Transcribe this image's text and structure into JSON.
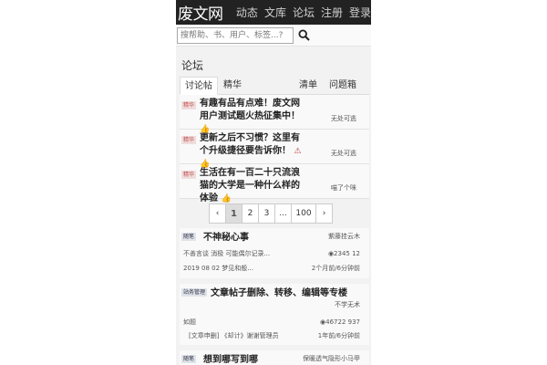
{
  "navbar": {
    "logo": "废文网",
    "items": [
      "动态",
      "文库",
      "论坛",
      "注册",
      "登录"
    ]
  },
  "search": {
    "placeholder": "搜帮助、书、用户、标签...?"
  },
  "forum": {
    "title": "论坛",
    "tabs": [
      "讨论帖",
      "精华",
      "清单",
      "问题箱"
    ]
  },
  "posts": [
    {
      "badge": "精华",
      "title": "有趣有品有点难！废文网用户测试题火热征集中！",
      "meta": "无处可逃"
    },
    {
      "badge": "精华",
      "title": "更新之后不习惯？这里有个升级捷径要告诉你！",
      "meta": "无处可逃"
    },
    {
      "badge": "精华",
      "title": "生活在有一百二十只流浪猫的大学是一种什么样的体验",
      "meta": "喵了个咪"
    }
  ],
  "pagination": [
    "‹",
    "1",
    "2",
    "3",
    "...",
    "100",
    "›"
  ],
  "topics": [
    {
      "tag": "随笔",
      "title": "不神秘心事",
      "author": "紫藤挂云木",
      "excerpt": "不善言谈 消极 可能偶尔记录...",
      "date": "2019 08 02 梦见和般...",
      "stats": "2345 12",
      "time": "2个月前/6分钟前"
    },
    {
      "tag": "站务管理",
      "title": "文章帖子删除、转移、编辑等专楼",
      "author": "不学无术",
      "excerpt": "如题",
      "sub": "[文章申删] 《却计》谢谢管理员",
      "stats": "46722 937",
      "time": "1年前/6分钟前"
    },
    {
      "tag": "随笔",
      "title": "想到哪写到哪",
      "author": "保暖透气隐形小马甲"
    }
  ]
}
